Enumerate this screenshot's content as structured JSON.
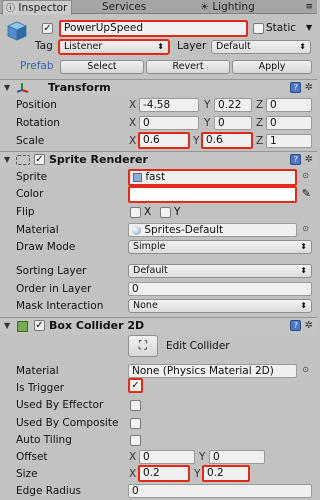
{
  "tabs": {
    "inspector": "Inspector",
    "services": "Services",
    "lighting": "Lighting"
  },
  "object": {
    "name": "PowerUpSpeed",
    "static_label": "Static",
    "tag_label": "Tag",
    "tag_value": "Listener",
    "layer_label": "Layer",
    "layer_value": "Default",
    "prefab_label": "Prefab",
    "select_btn": "Select",
    "revert_btn": "Revert",
    "apply_btn": "Apply"
  },
  "transform": {
    "title": "Transform",
    "position_label": "Position",
    "rotation_label": "Rotation",
    "scale_label": "Scale",
    "position": {
      "x": "-4.58",
      "y": "0.22",
      "z": "0"
    },
    "rotation": {
      "x": "0",
      "y": "0",
      "z": "0"
    },
    "scale": {
      "x": "0.6",
      "y": "0.6",
      "z": "1"
    }
  },
  "axes": {
    "x": "X",
    "y": "Y",
    "z": "Z"
  },
  "sprite_renderer": {
    "title": "Sprite Renderer",
    "sprite_label": "Sprite",
    "sprite_value": "fast",
    "color_label": "Color",
    "flip_label": "Flip",
    "flip_x": "X",
    "flip_y": "Y",
    "material_label": "Material",
    "material_value": "Sprites-Default",
    "draw_mode_label": "Draw Mode",
    "draw_mode_value": "Simple",
    "sorting_layer_label": "Sorting Layer",
    "sorting_layer_value": "Default",
    "order_label": "Order in Layer",
    "order_value": "0",
    "mask_label": "Mask Interaction",
    "mask_value": "None"
  },
  "box_collider": {
    "title": "Box Collider 2D",
    "edit_collider": "Edit Collider",
    "material_label": "Material",
    "material_value": "None (Physics Material 2D)",
    "is_trigger_label": "Is Trigger",
    "used_by_effector_label": "Used By Effector",
    "used_by_composite_label": "Used By Composite",
    "auto_tiling_label": "Auto Tiling",
    "offset_label": "Offset",
    "offset": {
      "x": "0",
      "y": "0"
    },
    "size_label": "Size",
    "size": {
      "x": "0.2",
      "y": "0.2"
    },
    "edge_radius_label": "Edge Radius",
    "edge_radius_value": "0"
  },
  "colors": {
    "highlight": "#e02a1c",
    "panel": "#c2c2c2",
    "help_icon": "#4a78c2"
  }
}
